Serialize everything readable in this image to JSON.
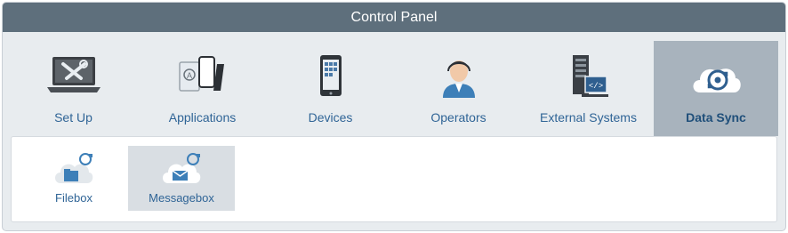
{
  "window": {
    "title": "Control Panel"
  },
  "tabs": [
    {
      "label": "Set Up",
      "icon": "tools-laptop-icon"
    },
    {
      "label": "Applications",
      "icon": "apps-devices-icon"
    },
    {
      "label": "Devices",
      "icon": "mobile-device-icon"
    },
    {
      "label": "Operators",
      "icon": "operator-person-icon"
    },
    {
      "label": "External Systems",
      "icon": "server-code-icon"
    },
    {
      "label": "Data Sync",
      "icon": "cloud-sync-icon",
      "active": true
    }
  ],
  "subitems": [
    {
      "label": "Filebox",
      "icon": "cloud-folder-sync-icon"
    },
    {
      "label": "Messagebox",
      "icon": "cloud-mail-sync-icon",
      "selected": true
    }
  ],
  "colors": {
    "titlebar": "#5e6f7c",
    "active_tab": "#a8b3bd",
    "label_text": "#2f6496",
    "selected_subitem": "#d9dee3"
  }
}
